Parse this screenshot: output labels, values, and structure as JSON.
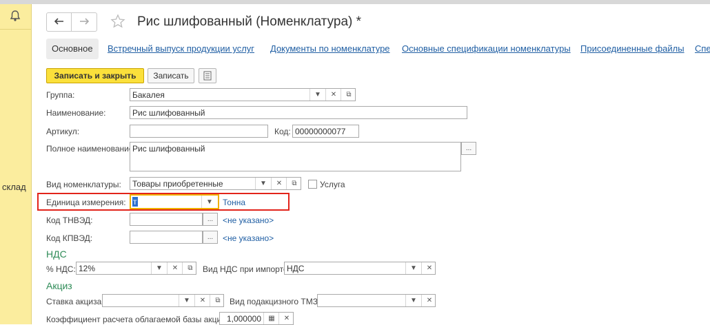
{
  "window": {
    "title": "Рис шлифованный (Номенклатура) *",
    "side_label": "склад"
  },
  "tabs": [
    {
      "label": "Основное"
    },
    {
      "label": "Встречный выпуск продукции услуг"
    },
    {
      "label": "Документы по номенклатуре"
    },
    {
      "label": "Основные спецификации номенклатуры"
    },
    {
      "label": "Присоединенные файлы"
    },
    {
      "label": "Спе"
    }
  ],
  "toolbar": {
    "save_close_label": "Записать и закрыть",
    "save_label": "Записать"
  },
  "fields": {
    "group": {
      "label": "Группа:",
      "value": "Бакалея"
    },
    "name": {
      "label": "Наименование:",
      "value": "Рис шлифованный"
    },
    "article": {
      "label": "Артикул:",
      "value": ""
    },
    "code": {
      "label": "Код:",
      "value": "00000000077"
    },
    "full_name": {
      "label": "Полное наименование:",
      "value": "Рис шлифованный"
    },
    "kind": {
      "label": "Вид номенклатуры:",
      "value": "Товары приобретенные"
    },
    "service": {
      "label": "Услуга",
      "checked": false
    },
    "unit": {
      "label": "Единица измерения:",
      "value": "т",
      "hint": "Тонна"
    },
    "tnved": {
      "label": "Код ТНВЭД:",
      "value": "",
      "hint": "<не указано>"
    },
    "kpved": {
      "label": "Код КПВЭД:",
      "value": "",
      "hint": "<не указано>"
    }
  },
  "vat": {
    "section": "НДС",
    "rate_label": "% НДС:",
    "rate_value": "12%",
    "import_label": "Вид НДС при импорте:",
    "import_value": "НДС"
  },
  "excise": {
    "section": "Акциз",
    "rate_label": "Ставка акциза:",
    "rate_value": "",
    "type_label": "Вид подакцизного ТМЗ:",
    "type_value": "",
    "coef_label": "Коэффициент расчета облагаемой базы акциза:",
    "coef_value": "1,000000"
  },
  "icons": {
    "bell": "bell-icon",
    "back": "arrow-left-icon",
    "forward": "arrow-right-icon",
    "star": "star-icon",
    "doc": "document-list-icon",
    "dropdown": "chevron-down-icon",
    "clear": "close-icon",
    "open": "open-form-icon",
    "select": "ellipsis-icon",
    "calc": "calculator-icon"
  },
  "colors": {
    "accent": "#fbe03b",
    "link": "#1f5ea3",
    "section": "#2e8b57",
    "highlight": "#e2231a",
    "sidebar": "#fbed9e"
  }
}
